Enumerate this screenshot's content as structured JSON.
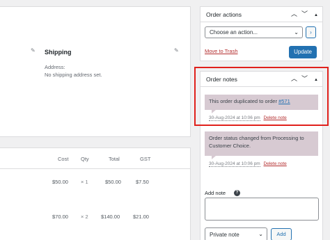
{
  "shipping": {
    "title": "Shipping",
    "address_label": "Address:",
    "address_value": "No shipping address set."
  },
  "items": {
    "columns": {
      "cost": "Cost",
      "qty": "Qty",
      "total": "Total",
      "tax": "GST"
    },
    "rows": [
      {
        "cost": "$50.00",
        "qty": "× 1",
        "total": "$50.00",
        "tax": "$7.50"
      },
      {
        "cost": "$70.00",
        "qty": "× 2",
        "total": "$140.00",
        "tax": "$21.00"
      }
    ]
  },
  "order_actions": {
    "title": "Order actions",
    "select_value": "Choose an action...",
    "go_label": "›",
    "trash_label": "Move to Trash",
    "update_label": "Update"
  },
  "order_notes": {
    "title": "Order notes",
    "notes": [
      {
        "text": "This order duplicated to order ",
        "link": "#571",
        "date": "30-Aug-2024 at 10:06 pm",
        "delete": "Delete note"
      },
      {
        "text": "Order status changed from Processing to Customer Choice.",
        "date": "30-Aug-2024 at 10:06 pm",
        "delete": "Delete note"
      }
    ],
    "add_note_label": "Add note",
    "help_glyph": "?",
    "note_type_value": "Private note",
    "add_button_label": "Add"
  },
  "icons": {
    "pencil": "✎",
    "up": "︿",
    "down": "﹀",
    "toggle": "▲",
    "chevron": "⌄"
  },
  "colors": {
    "primary": "#2271b1",
    "danger": "#b32d2e",
    "note_bg": "#d7cad2",
    "highlight": "#e0201b"
  }
}
